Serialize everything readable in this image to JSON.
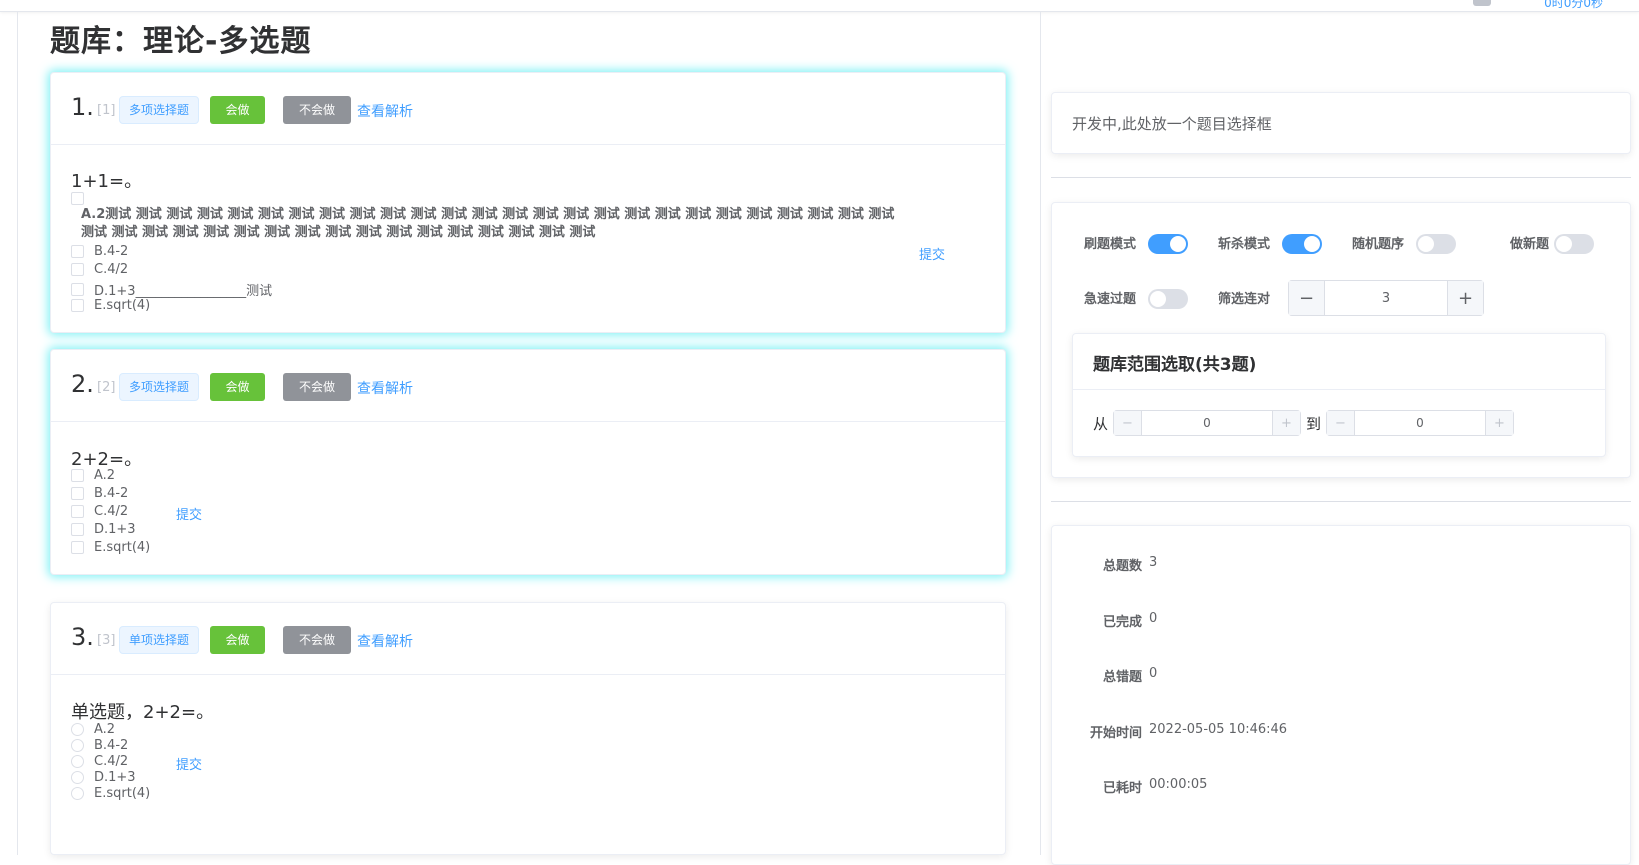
{
  "header": {
    "timer": "0时0分0秒"
  },
  "page": {
    "title": "题库：理论-多选题"
  },
  "questions": [
    {
      "number": "1.",
      "index": "[1]",
      "type_tag": "多项选择题",
      "know_label": "会做",
      "dont_know_label": "不会做",
      "analysis_label": "查看解析",
      "text": "1+1=。",
      "options": [
        "A.2测试 测试 测试 测试 测试 测试 测试 测试 测试 测试 测试 测试 测试 测试 测试 测试 测试 测试 测试 测试 测试 测试 测试 测试 测试 测试 测试 测试 测试 测试 测试 测试 测试 测试 测试 测试 测试 测试 测试 测试 测试 测试 测试",
        "B.4-2",
        "C.4/2",
        "D.1+3_________________测试",
        "E.sqrt(4)"
      ],
      "submit_label": "提交"
    },
    {
      "number": "2.",
      "index": "[2]",
      "type_tag": "多项选择题",
      "know_label": "会做",
      "dont_know_label": "不会做",
      "analysis_label": "查看解析",
      "text": "2+2=。",
      "options": [
        "A.2",
        "B.4-2",
        "C.4/2",
        "D.1+3",
        "E.sqrt(4)"
      ],
      "submit_label": "提交"
    },
    {
      "number": "3.",
      "index": "[3]",
      "type_tag": "单项选择题",
      "know_label": "会做",
      "dont_know_label": "不会做",
      "analysis_label": "查看解析",
      "text": "单选题，2+2=。",
      "options": [
        "A.2",
        "B.4-2",
        "C.4/2",
        "D.1+3",
        "E.sqrt(4)"
      ],
      "submit_label": "提交"
    }
  ],
  "side": {
    "placeholder": "开发中,此处放一个题目选择框",
    "settings": {
      "practice_mode": {
        "label": "刷题模式",
        "on": true
      },
      "kill_mode": {
        "label": "斩杀模式",
        "on": true
      },
      "random_order": {
        "label": "随机题序",
        "on": false
      },
      "new_questions": {
        "label": "做新题",
        "on": false
      },
      "fast_pass": {
        "label": "急速过题",
        "on": false
      },
      "filter_label": "筛选连对",
      "filter_value": "3",
      "minus": "−",
      "plus": "+"
    },
    "range": {
      "title": "题库范围选取(共3题)",
      "from_label": "从",
      "from_value": "0",
      "to_label": "到",
      "to_value": "0"
    },
    "stats": [
      {
        "label": "总题数",
        "value": "3"
      },
      {
        "label": "已完成",
        "value": "0"
      },
      {
        "label": "总错题",
        "value": "0"
      },
      {
        "label": "开始时间",
        "value": "2022-05-05 10:46:46"
      },
      {
        "label": "已耗时",
        "value": "00:00:05"
      }
    ]
  }
}
